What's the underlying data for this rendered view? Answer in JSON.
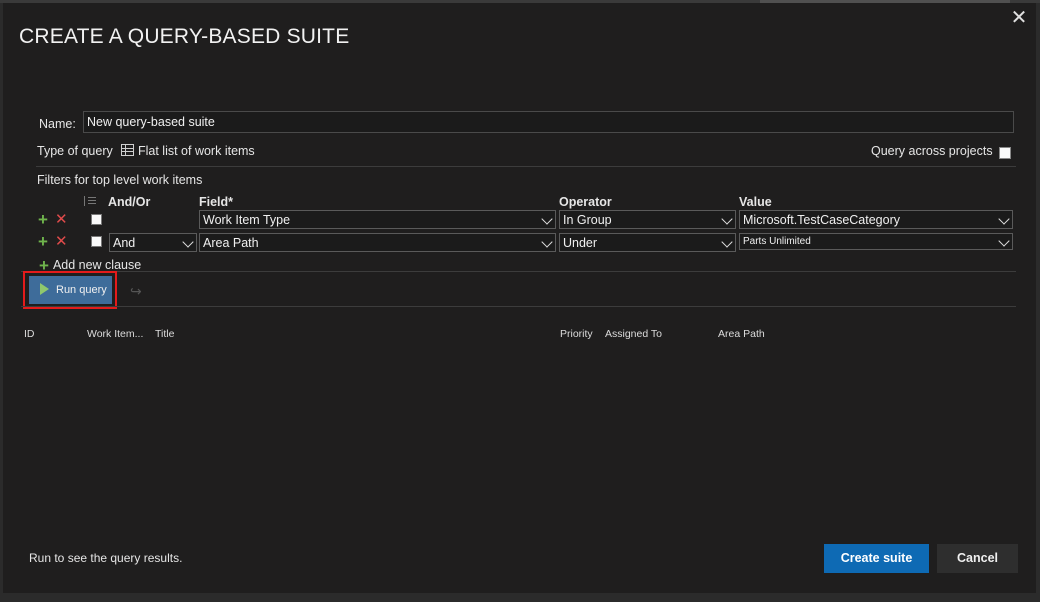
{
  "dialog": {
    "title": "CREATE A QUERY-BASED SUITE",
    "close_symbol": "✕"
  },
  "form": {
    "name_label": "Name:",
    "name_value": "New query-based suite",
    "type_label": "Type of query",
    "type_value": "Flat list of work items",
    "query_across_label": "Query across projects",
    "query_across_checked": false,
    "filters_label": "Filters for top level work items"
  },
  "filter_columns": {
    "and_or": "And/Or",
    "field": "Field*",
    "operator": "Operator",
    "value": "Value"
  },
  "clauses": [
    {
      "and_or": "",
      "field": "Work Item Type",
      "operator": "In Group",
      "value": "Microsoft.TestCaseCategory"
    },
    {
      "and_or": "And",
      "field": "Area Path",
      "operator": "Under",
      "value": "Parts Unlimited"
    }
  ],
  "add_clause_label": "Add new clause",
  "toolbar": {
    "run_query_label": "Run query",
    "redo_symbol": "↪"
  },
  "results_columns": [
    "ID",
    "Work Item...",
    "Title",
    "Priority",
    "Assigned To",
    "Area Path"
  ],
  "status_text": "Run to see the query results.",
  "footer": {
    "create_label": "Create suite",
    "cancel_label": "Cancel"
  },
  "colors": {
    "dialog_bg": "#1f1e1e",
    "primary_button": "#0e6ab4",
    "run_button": "#3e6c9a",
    "highlight_border": "#e31b1b",
    "add_green": "#6fb44c",
    "delete_red": "#e04b4b"
  }
}
